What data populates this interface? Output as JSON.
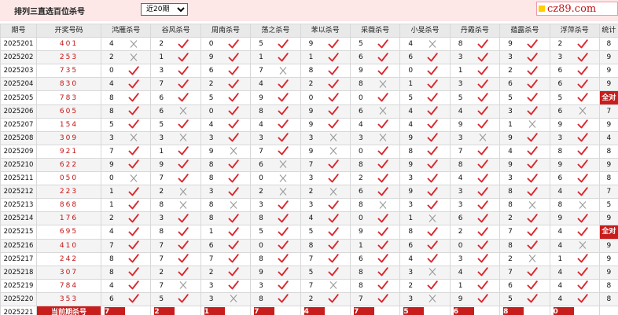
{
  "header": {
    "title": "排列三直选百位杀号",
    "period_select": "近20期",
    "logo": "cz89.com"
  },
  "columns": {
    "period": "期号",
    "draw": "开奖号码",
    "experts": [
      "鸿雁杀号",
      "谷风杀号",
      "周南杀号",
      "荡之杀号",
      "苯以杀号",
      "采薇杀号",
      "小旻杀号",
      "丹霞杀号",
      "蕴露杀号",
      "浮萍杀号"
    ],
    "stat": "统计"
  },
  "rows": [
    {
      "period": "2025201",
      "draw": "401",
      "picks": [
        4,
        2,
        0,
        5,
        9,
        5,
        4,
        8,
        9,
        2
      ],
      "hits": [
        0,
        1,
        1,
        1,
        1,
        1,
        0,
        1,
        1,
        1
      ],
      "stat": "8"
    },
    {
      "period": "2025202",
      "draw": "253",
      "picks": [
        2,
        1,
        9,
        1,
        1,
        6,
        6,
        3,
        3,
        3
      ],
      "hits": [
        0,
        1,
        1,
        1,
        1,
        1,
        1,
        1,
        1,
        1
      ],
      "stat": "9"
    },
    {
      "period": "2025203",
      "draw": "735",
      "picks": [
        0,
        3,
        6,
        7,
        8,
        9,
        0,
        1,
        2,
        6
      ],
      "hits": [
        1,
        1,
        1,
        0,
        1,
        1,
        1,
        1,
        1,
        1
      ],
      "stat": "9"
    },
    {
      "period": "2025204",
      "draw": "830",
      "picks": [
        4,
        7,
        2,
        4,
        2,
        8,
        1,
        3,
        6,
        6
      ],
      "hits": [
        1,
        1,
        1,
        1,
        1,
        0,
        1,
        1,
        1,
        1
      ],
      "stat": "9"
    },
    {
      "period": "2025205",
      "draw": "783",
      "picks": [
        8,
        6,
        5,
        9,
        0,
        0,
        5,
        5,
        5,
        5
      ],
      "hits": [
        1,
        1,
        1,
        1,
        1,
        1,
        1,
        1,
        1,
        1
      ],
      "stat": "全对"
    },
    {
      "period": "2025206",
      "draw": "605",
      "picks": [
        8,
        6,
        0,
        8,
        9,
        6,
        4,
        4,
        3,
        6
      ],
      "hits": [
        1,
        0,
        1,
        1,
        1,
        0,
        1,
        1,
        1,
        0
      ],
      "stat": "7"
    },
    {
      "period": "2025207",
      "draw": "154",
      "picks": [
        5,
        5,
        4,
        4,
        9,
        4,
        4,
        9,
        1,
        9
      ],
      "hits": [
        1,
        1,
        1,
        1,
        1,
        1,
        1,
        1,
        0,
        1
      ],
      "stat": "9"
    },
    {
      "period": "2025208",
      "draw": "309",
      "picks": [
        3,
        3,
        3,
        3,
        3,
        3,
        9,
        3,
        9,
        3
      ],
      "hits": [
        0,
        0,
        1,
        1,
        0,
        0,
        1,
        0,
        1,
        1
      ],
      "stat": "4"
    },
    {
      "period": "2025209",
      "draw": "921",
      "picks": [
        7,
        1,
        9,
        7,
        9,
        0,
        8,
        7,
        4,
        8
      ],
      "hits": [
        1,
        1,
        0,
        1,
        0,
        1,
        1,
        1,
        1,
        1
      ],
      "stat": "8"
    },
    {
      "period": "2025210",
      "draw": "622",
      "picks": [
        9,
        9,
        8,
        6,
        7,
        8,
        9,
        8,
        9,
        9
      ],
      "hits": [
        1,
        1,
        1,
        0,
        1,
        1,
        1,
        1,
        1,
        1
      ],
      "stat": "9"
    },
    {
      "period": "2025211",
      "draw": "050",
      "picks": [
        0,
        7,
        8,
        0,
        3,
        2,
        3,
        4,
        3,
        6
      ],
      "hits": [
        0,
        1,
        1,
        0,
        1,
        1,
        1,
        1,
        1,
        1
      ],
      "stat": "8"
    },
    {
      "period": "2025212",
      "draw": "223",
      "picks": [
        1,
        2,
        3,
        2,
        2,
        6,
        9,
        3,
        8,
        4
      ],
      "hits": [
        1,
        0,
        1,
        0,
        0,
        1,
        1,
        1,
        1,
        1
      ],
      "stat": "7"
    },
    {
      "period": "2025213",
      "draw": "868",
      "picks": [
        1,
        8,
        8,
        3,
        3,
        8,
        3,
        3,
        8,
        8
      ],
      "hits": [
        1,
        0,
        0,
        1,
        1,
        0,
        1,
        1,
        0,
        0
      ],
      "stat": "5"
    },
    {
      "period": "2025214",
      "draw": "176",
      "picks": [
        2,
        3,
        8,
        8,
        4,
        0,
        1,
        6,
        2,
        9
      ],
      "hits": [
        1,
        1,
        1,
        1,
        1,
        1,
        0,
        1,
        1,
        1
      ],
      "stat": "9"
    },
    {
      "period": "2025215",
      "draw": "695",
      "picks": [
        4,
        8,
        1,
        5,
        5,
        9,
        8,
        2,
        7,
        4
      ],
      "hits": [
        1,
        1,
        1,
        1,
        1,
        1,
        1,
        1,
        1,
        1
      ],
      "stat": "全对"
    },
    {
      "period": "2025216",
      "draw": "410",
      "picks": [
        7,
        7,
        6,
        0,
        8,
        1,
        6,
        0,
        8,
        4
      ],
      "hits": [
        1,
        1,
        1,
        1,
        1,
        1,
        1,
        1,
        1,
        0
      ],
      "stat": "9"
    },
    {
      "period": "2025217",
      "draw": "242",
      "picks": [
        8,
        7,
        7,
        8,
        7,
        6,
        4,
        3,
        2,
        1
      ],
      "hits": [
        1,
        1,
        1,
        1,
        1,
        1,
        1,
        1,
        0,
        1
      ],
      "stat": "9"
    },
    {
      "period": "2025218",
      "draw": "307",
      "picks": [
        8,
        2,
        2,
        9,
        5,
        8,
        3,
        4,
        7,
        4
      ],
      "hits": [
        1,
        1,
        1,
        1,
        1,
        1,
        0,
        1,
        1,
        1
      ],
      "stat": "9"
    },
    {
      "period": "2025219",
      "draw": "784",
      "picks": [
        4,
        7,
        3,
        3,
        7,
        8,
        2,
        1,
        6,
        4
      ],
      "hits": [
        1,
        0,
        1,
        1,
        0,
        1,
        1,
        1,
        1,
        1
      ],
      "stat": "8"
    },
    {
      "period": "2025220",
      "draw": "353",
      "picks": [
        6,
        5,
        3,
        8,
        2,
        7,
        3,
        9,
        5,
        4
      ],
      "hits": [
        1,
        1,
        0,
        1,
        1,
        1,
        0,
        1,
        1,
        1
      ],
      "stat": "8"
    }
  ],
  "footer": {
    "period": "2025221",
    "label": "当前期杀号",
    "picks": [
      "7",
      "2",
      "1",
      "7",
      "4",
      "7",
      "5",
      "6",
      "8",
      "0"
    ]
  }
}
